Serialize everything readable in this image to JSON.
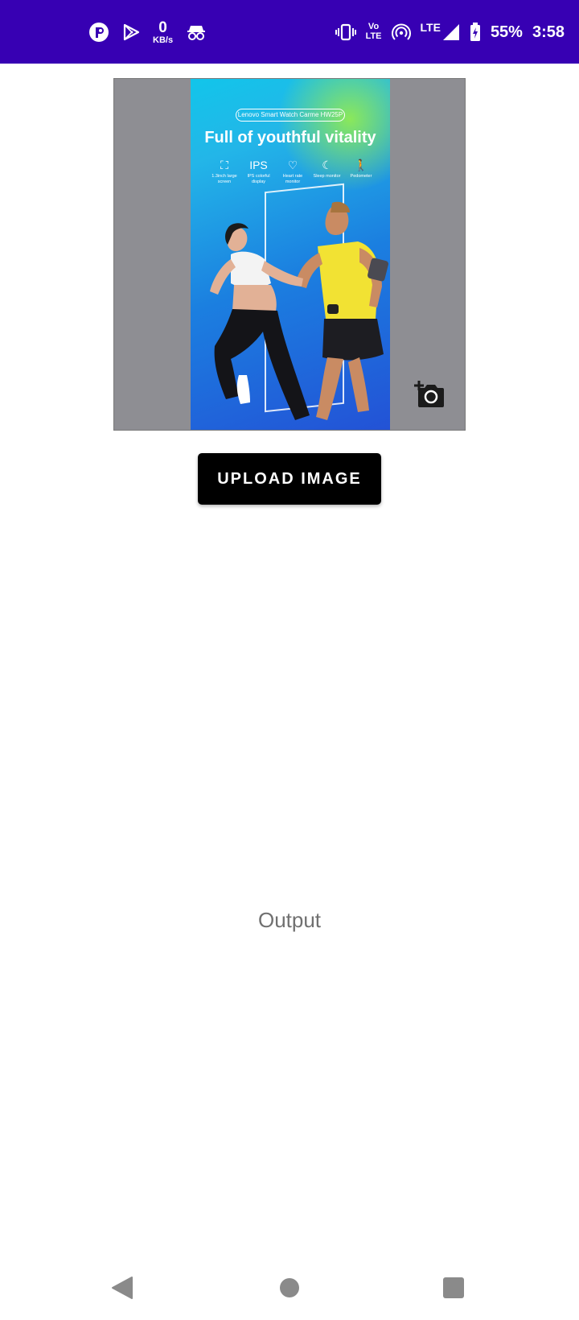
{
  "status_bar": {
    "net_speed_value": "0",
    "net_speed_unit": "KB/s",
    "volte_line1": "Vo",
    "volte_line2": "LTE",
    "lte_label": "LTE",
    "battery_percent": "55%",
    "time": "3:58",
    "background_color": "#3700b3",
    "icons": [
      "app-icon",
      "play-store-icon",
      "incognito-icon",
      "vibrate-icon",
      "volte-icon",
      "hotspot-icon",
      "lte-signal-icon",
      "battery-charging-icon"
    ]
  },
  "preview": {
    "poster_tag": "Lenovo Smart Watch Carme HW25P",
    "poster_headline": "Full of youthful vitality",
    "features": [
      {
        "icon": "⛶",
        "label": "1.3inch large screen"
      },
      {
        "icon": "IPS",
        "label": "IPS colorful display"
      },
      {
        "icon": "♡",
        "label": "Heart rate monitor"
      },
      {
        "icon": "☾",
        "label": "Sleep monitor"
      },
      {
        "icon": "🚶",
        "label": "Pedometer"
      }
    ],
    "camera_icon": "add-photo-icon"
  },
  "upload_button_label": "UPLOAD IMAGE",
  "output_label": "Output",
  "nav": {
    "icons": [
      "back-icon",
      "home-icon",
      "recents-icon"
    ]
  }
}
